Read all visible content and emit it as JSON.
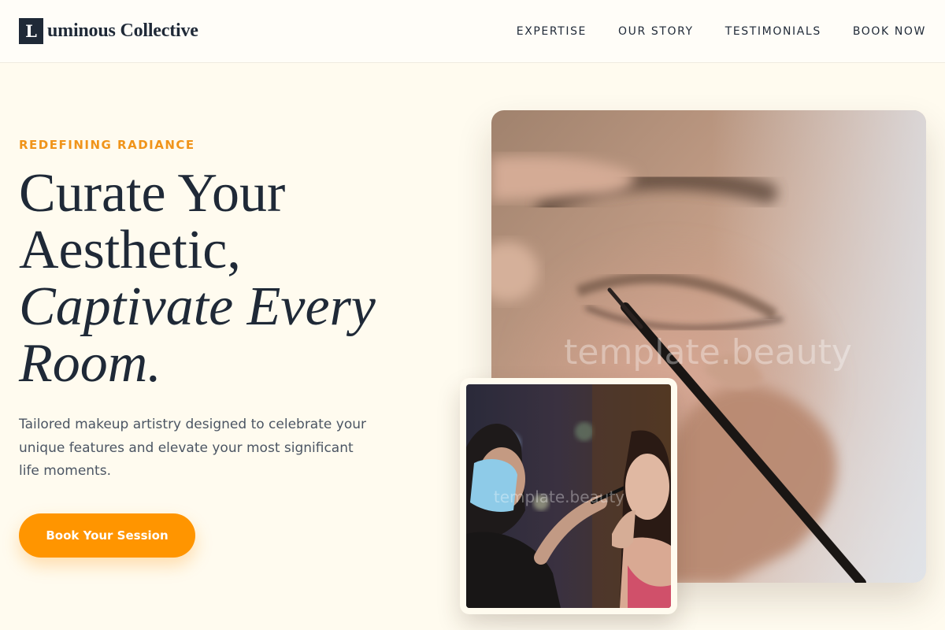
{
  "header": {
    "logo_mark": "L",
    "logo_text": "uminous Collective",
    "nav": [
      "EXPERTISE",
      "OUR STORY",
      "TESTIMONIALS",
      "BOOK NOW"
    ]
  },
  "hero": {
    "eyebrow": "REDEFINING RADIANCE",
    "headline_line1": "Curate Your",
    "headline_line2": "Aesthetic,",
    "headline_line3": "Captivate Every",
    "headline_line4": "Room.",
    "subtext": "Tailored makeup artistry designed to celebrate your unique features and elevate your most significant life moments.",
    "cta_label": "Book Your Session"
  },
  "images": {
    "main_watermark": "template.beauty",
    "inset_watermark": "template.beauty"
  },
  "colors": {
    "accent": "#ff9500",
    "eyebrow": "#f0941a",
    "ink": "#1f2937",
    "background": "#fffbef"
  }
}
